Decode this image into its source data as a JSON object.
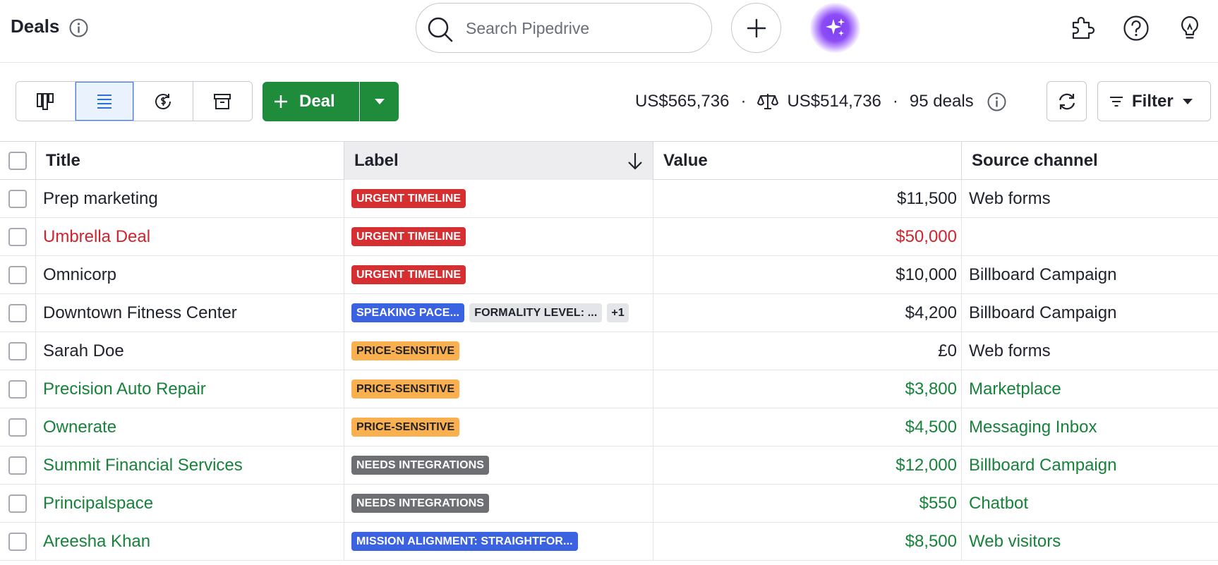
{
  "header": {
    "title": "Deals",
    "search_placeholder": "Search Pipedrive"
  },
  "toolbar": {
    "views": [
      {
        "name": "pipeline-view",
        "icon": "pipeline-icon"
      },
      {
        "name": "list-view",
        "icon": "list-icon",
        "active": true
      },
      {
        "name": "forecast-view",
        "icon": "forecast-icon"
      },
      {
        "name": "archive-view",
        "icon": "archive-icon"
      }
    ],
    "deal_button_label": "Deal",
    "summary_total": "US$565,736",
    "summary_weighted": "US$514,736",
    "summary_count": "95 deals",
    "separator": "·",
    "filter_label": "Filter"
  },
  "table": {
    "columns": {
      "title": "Title",
      "label": "Label",
      "value": "Value",
      "source": "Source channel"
    },
    "rows": [
      {
        "title": "Prep marketing",
        "labels": [
          {
            "text": "URGENT TIMELINE",
            "color": "red"
          }
        ],
        "value": "$11,500",
        "source": "Web forms",
        "status": "default"
      },
      {
        "title": "Umbrella Deal",
        "labels": [
          {
            "text": "URGENT TIMELINE",
            "color": "red"
          }
        ],
        "value": "$50,000",
        "source": "",
        "status": "red"
      },
      {
        "title": "Omnicorp",
        "labels": [
          {
            "text": "URGENT TIMELINE",
            "color": "red"
          }
        ],
        "value": "$10,000",
        "source": "Billboard Campaign",
        "status": "default"
      },
      {
        "title": "Downtown Fitness Center",
        "labels": [
          {
            "text": "SPEAKING PACE...",
            "color": "blue"
          },
          {
            "text": "FORMALITY LEVEL: ...",
            "color": "lightgray"
          },
          {
            "text": "+1",
            "color": "more"
          }
        ],
        "value": "$4,200",
        "source": "Billboard Campaign",
        "status": "default"
      },
      {
        "title": "Sarah Doe",
        "labels": [
          {
            "text": "PRICE-SENSITIVE",
            "color": "orange"
          }
        ],
        "value": "£0",
        "source": "Web forms",
        "status": "default"
      },
      {
        "title": "Precision Auto Repair",
        "labels": [
          {
            "text": "PRICE-SENSITIVE",
            "color": "orange"
          }
        ],
        "value": "$3,800",
        "source": "Marketplace",
        "status": "green"
      },
      {
        "title": "Ownerate",
        "labels": [
          {
            "text": "PRICE-SENSITIVE",
            "color": "orange"
          }
        ],
        "value": "$4,500",
        "source": "Messaging Inbox",
        "status": "green"
      },
      {
        "title": "Summit Financial Services",
        "labels": [
          {
            "text": "NEEDS INTEGRATIONS",
            "color": "darkgray"
          }
        ],
        "value": "$12,000",
        "source": "Billboard Campaign",
        "status": "green"
      },
      {
        "title": "Principalspace",
        "labels": [
          {
            "text": "NEEDS INTEGRATIONS",
            "color": "darkgray"
          }
        ],
        "value": "$550",
        "source": "Chatbot",
        "status": "green"
      },
      {
        "title": "Areesha Khan",
        "labels": [
          {
            "text": "MISSION ALIGNMENT: STRAIGHTFOR...",
            "color": "blue"
          }
        ],
        "value": "$8,500",
        "source": "Web visitors",
        "status": "green"
      }
    ]
  },
  "colors": {
    "brand_green": "#1f8c3c",
    "lost_red": "#d0252d",
    "won_green": "#16823a",
    "active_blue": "#3d7ee8"
  }
}
